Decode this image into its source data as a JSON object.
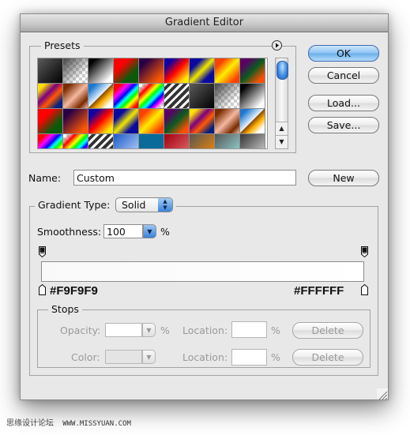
{
  "window": {
    "title": "Gradient Editor"
  },
  "presets": {
    "label": "Presets",
    "menu_icon": "flyout-menu-icon",
    "swatches": [
      {
        "name": "foreground-to-background",
        "css": "linear-gradient(135deg,#5a5a5a,#000)"
      },
      {
        "name": "foreground-to-transparent",
        "css": "linear-gradient(135deg,#444 0%,rgba(68,68,68,0) 75%),repeating-conic-gradient(#ccc 0 25%,#fff 0 50%) 0 0/8px 8px"
      },
      {
        "name": "black-white",
        "css": "linear-gradient(135deg,#000 15%,#fff 85%)"
      },
      {
        "name": "red-green",
        "css": "linear-gradient(135deg,#ff0000 30%,#0b5a0b 70%)"
      },
      {
        "name": "violet-orange",
        "css": "linear-gradient(135deg,#2a0044 20%,#ff5a00 85%)"
      },
      {
        "name": "blue-red-yellow",
        "css": "linear-gradient(135deg,#1200a0 20%,#ff0000 50%,#ffe600 85%)"
      },
      {
        "name": "blue-yellow-blue",
        "css": "linear-gradient(135deg,#0a0aa0 25%,#f0e800 50%,#0a0aa0 75%)"
      },
      {
        "name": "orange-yellow-orange",
        "css": "linear-gradient(135deg,#ff4000 20%,#ffee00 50%,#ff4000 85%)"
      },
      {
        "name": "violet-green-orange",
        "css": "linear-gradient(135deg,#5a0066 20%,#0a5a20 50%,#ff5000 85%)"
      },
      {
        "name": "yellow-violet-orange-blue",
        "css": "linear-gradient(135deg,#ffe000 15%,#7a0080 40%,#ff5a00 60%,#002080 85%)"
      },
      {
        "name": "copper",
        "css": "linear-gradient(135deg,#7a2a00 15%,#f4b8a0 50%,#7a2a00 80%,#f0c0b0)"
      },
      {
        "name": "chrome",
        "css": "linear-gradient(135deg,#1a78d0 15%,#e8f4ff 48%,#8a4a00 50%,#ffb000 65%,#fff 85%)"
      },
      {
        "name": "spectrum",
        "css": "linear-gradient(135deg,#ff0000 15%,#ff00ff 30%,#0000ff 45%,#00ffff 55%,#00ff00 65%,#ffff00 75%,#ff0000 90%)"
      },
      {
        "name": "transparent-rainbow",
        "css": "linear-gradient(135deg,rgba(255,0,0,0) 10%,#ff0000 25%,#ffff00 40%,#00ff00 50%,#00ffff 60%,#0000ff 70%,#ff00ff 80%,rgba(255,0,255,0) 90%),repeating-conic-gradient(#ccc 0 25%,#fff 0 50%) 0 0/8px 8px"
      },
      {
        "name": "transparent-stripes",
        "css": "repeating-linear-gradient(135deg,#fff 0 3px,#333 3px 7px)"
      },
      {
        "name": "foreground-to-background-2",
        "css": "linear-gradient(135deg,#5a5a5a,#000)"
      },
      {
        "name": "foreground-to-transparent-2",
        "css": "linear-gradient(135deg,#444 0%,rgba(68,68,68,0) 75%),repeating-conic-gradient(#ccc 0 25%,#fff 0 50%) 0 0/8px 8px"
      },
      {
        "name": "black-white-2",
        "css": "linear-gradient(135deg,#000 15%,#fff 85%)"
      },
      {
        "name": "red-green-2",
        "css": "linear-gradient(135deg,#ff0000 30%,#0b5a0b 70%)"
      },
      {
        "name": "violet-orange-2",
        "css": "linear-gradient(135deg,#2a0044 20%,#ff5a00 85%)"
      },
      {
        "name": "blue-red-yellow-2",
        "css": "linear-gradient(135deg,#1200a0 20%,#ff0000 50%,#ffe600 85%)"
      },
      {
        "name": "blue-yellow-blue-2",
        "css": "linear-gradient(135deg,#0a0aa0 25%,#f0e800 50%,#0a0aa0 75%)"
      },
      {
        "name": "orange-yellow-orange-2",
        "css": "linear-gradient(135deg,#ff4000 20%,#ffee00 50%,#ff4000 85%)"
      },
      {
        "name": "violet-green-orange-2",
        "css": "linear-gradient(135deg,#5a0066 20%,#0a5a20 50%,#ff5000 85%)"
      },
      {
        "name": "yellow-violet-orange-blue-2",
        "css": "linear-gradient(135deg,#ffe000 15%,#7a0080 40%,#ff5a00 60%,#002080 85%)"
      },
      {
        "name": "copper-2",
        "css": "linear-gradient(135deg,#7a2a00 15%,#f4b8a0 50%,#7a2a00 80%,#f0c0b0)"
      },
      {
        "name": "chrome-2",
        "css": "linear-gradient(135deg,#1a78d0 15%,#e8f4ff 48%,#8a4a00 50%,#ffb000 65%,#fff 85%)"
      },
      {
        "name": "spectrum-2",
        "css": "linear-gradient(135deg,#ff0000 15%,#ff00ff 30%,#0000ff 45%,#00ffff 55%,#00ff00 65%,#ffff00 75%,#ff0000 90%)"
      },
      {
        "name": "transparent-rainbow-2",
        "css": "linear-gradient(135deg,rgba(255,0,0,0) 10%,#ff0000 25%,#ffff00 40%,#00ff00 50%,#00ffff 60%,#0000ff 70%,#ff00ff 80%,rgba(255,0,255,0) 90%),repeating-conic-gradient(#ccc 0 25%,#fff 0 50%) 0 0/8px 8px"
      },
      {
        "name": "transparent-stripes-2",
        "css": "repeating-linear-gradient(135deg,#fff 0 3px,#333 3px 7px)"
      },
      {
        "name": "blue-light",
        "css": "linear-gradient(135deg,#1a5ac8,#c8dcff)"
      },
      {
        "name": "teal",
        "css": "linear-gradient(180deg,#0a6a9a,#0a6a9a)"
      },
      {
        "name": "dark-red",
        "css": "linear-gradient(135deg,#a00010,#e87070)"
      },
      {
        "name": "grey-orange",
        "css": "linear-gradient(135deg,#555,#ff8a00)"
      },
      {
        "name": "grey-cyan",
        "css": "linear-gradient(135deg,#555,#9ae0e0)"
      },
      {
        "name": "grey-white",
        "css": "linear-gradient(135deg,#333,#ddd)"
      }
    ]
  },
  "buttons": {
    "ok": "OK",
    "cancel": "Cancel",
    "load": "Load...",
    "save": "Save...",
    "new": "New"
  },
  "name_field": {
    "label": "Name:",
    "value": "Custom"
  },
  "gradient": {
    "type_label": "Gradient Type:",
    "type_value": "Solid",
    "smoothness_label": "Smoothness:",
    "smoothness_value": "100",
    "smoothness_unit": "%",
    "left_color_hex": "#F9F9F9",
    "right_color_hex": "#FFFFFF",
    "start_color": "#f9f9f9",
    "end_color": "#ffffff"
  },
  "stops": {
    "label": "Stops",
    "opacity_label": "Opacity:",
    "opacity_value": "",
    "opacity_unit": "%",
    "color_label": "Color:",
    "location_label": "Location:",
    "location_opacity_value": "",
    "location_color_value": "",
    "location_unit": "%",
    "delete_label": "Delete"
  },
  "watermark": {
    "text": "思缘设计论坛",
    "url": "WWW.MISSYUAN.COM"
  }
}
